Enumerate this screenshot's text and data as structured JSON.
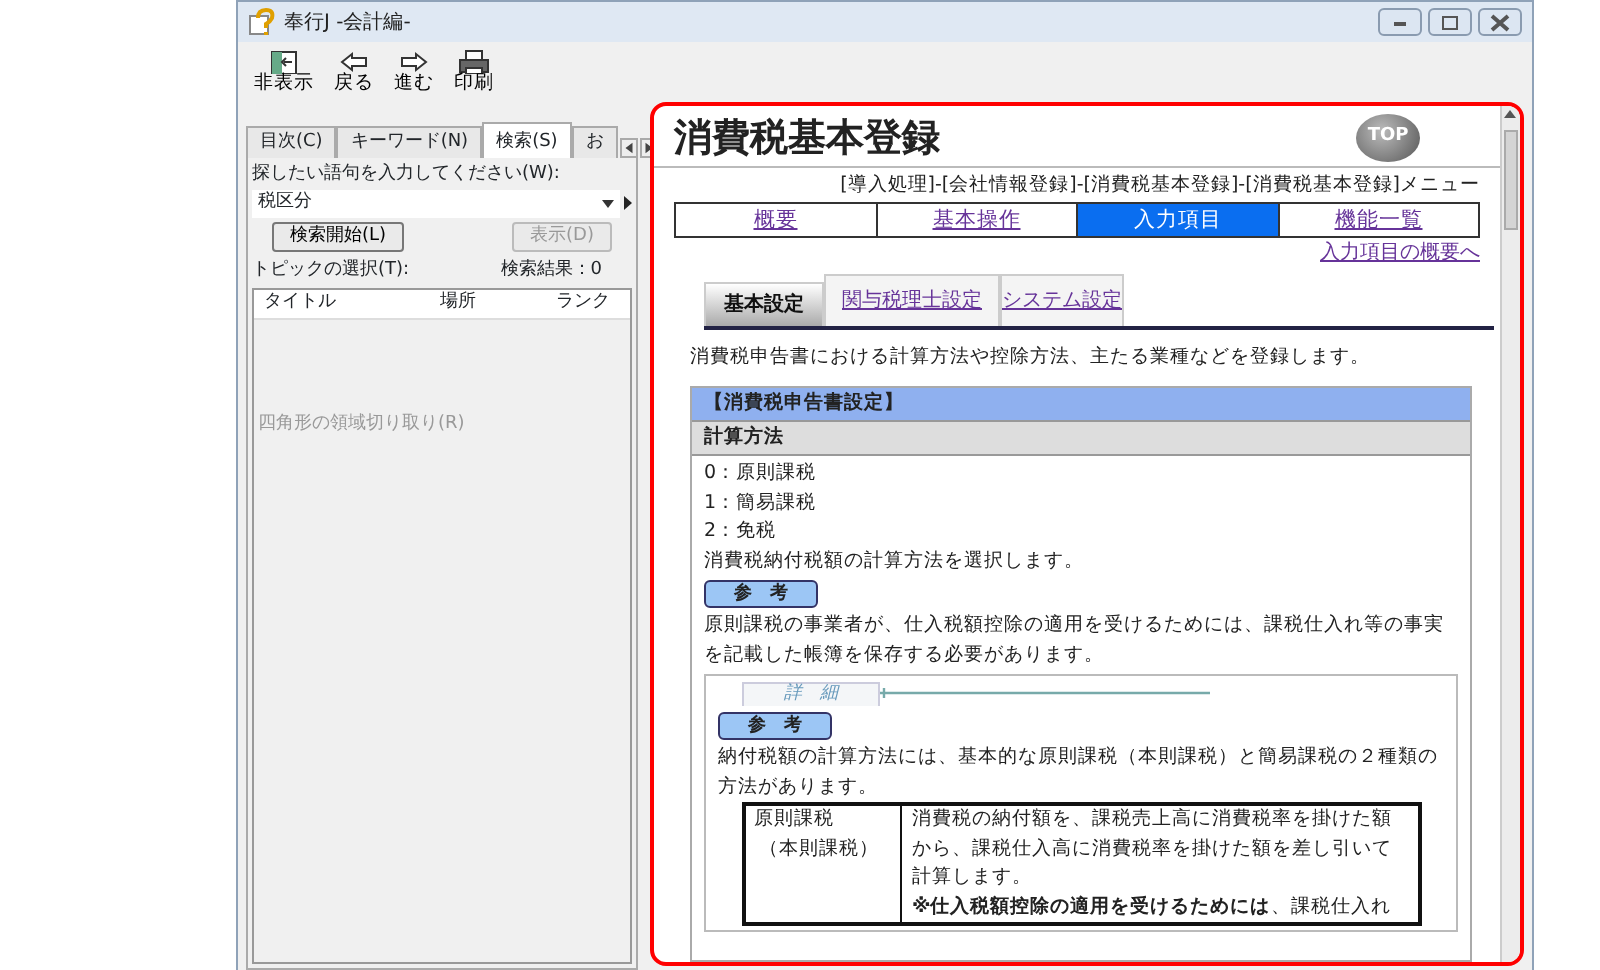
{
  "window": {
    "title": "奉行J -会計編-"
  },
  "toolbar": [
    {
      "label": "非表示",
      "kind": "hide"
    },
    {
      "label": "戻る",
      "kind": "back"
    },
    {
      "label": "進む",
      "kind": "forward"
    },
    {
      "label": "印刷",
      "kind": "print"
    }
  ],
  "nav_pane": {
    "tabs": [
      {
        "label": "目次(C)",
        "selected": false
      },
      {
        "label": "キーワード(N)",
        "selected": false
      },
      {
        "label": "検索(S)",
        "selected": true
      },
      {
        "label": "お",
        "selected": false
      }
    ],
    "search_label": "探したい語句を入力してください(W):",
    "search_value": "税区分",
    "search_button": "検索開始(L)",
    "display_button": {
      "label": "表示(D)",
      "disabled": true
    },
    "topic_label": "トピックの選択(T):",
    "result_count": "検索結果：0",
    "columns": [
      "タイトル",
      "場所",
      "ランク"
    ],
    "ghost_text": "四角形の領域切り取り(R)"
  },
  "content": {
    "title": "消費税基本登録",
    "top_button": "TOP",
    "breadcrumb": "[導入処理]-[会社情報登録]-[消費税基本登録]-[消費税基本登録]メニュー",
    "nav": [
      {
        "label": "概要",
        "selected": false
      },
      {
        "label": "基本操作",
        "selected": false
      },
      {
        "label": "入力項目",
        "selected": true
      },
      {
        "label": "機能一覧",
        "selected": false
      }
    ],
    "overview_link": "入力項目の概要へ",
    "tabs": [
      {
        "label": "基本設定",
        "selected": true
      },
      {
        "label": "関与税理士設定",
        "selected": false
      },
      {
        "label": "システム設定",
        "selected": false
      }
    ],
    "intro": "消費税申告書における計算方法や控除方法、主たる業種などを登録します。",
    "section": {
      "title": "【消費税申告書設定】",
      "subtitle": "計算方法",
      "options": [
        "0：原則課税",
        "1：簡易課税",
        "2：免税"
      ],
      "description": "消費税納付税額の計算方法を選択します。",
      "reference_label": "参　考",
      "reference_text": "原則課税の事業者が、仕入税額控除の適用を受けるためには、課税仕入れ等の事実を記載した帳簿を保存する必要があります。",
      "detail": {
        "tab_label": "詳　細",
        "reference_label": "参　考",
        "text": "納付税額の計算方法には、基本的な原則課税（本則課税）と簡易課税の２種類の方法があります。",
        "table": [
          {
            "term": [
              "原則課税",
              "（本則課税）"
            ],
            "definition": "消費税の納付額を、課税売上高に消費税率を掛けた額から、課税仕入高に消費税率を掛けた額を差し引いて計算します。",
            "note": "**※仕入税額控除の適用を受けるためには**、課税仕入れ"
          }
        ]
      }
    }
  }
}
